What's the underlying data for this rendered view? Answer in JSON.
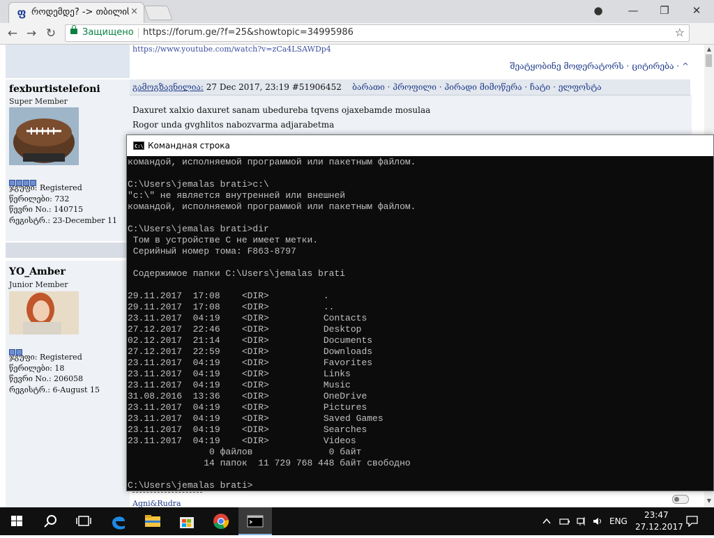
{
  "browser": {
    "tab_title": "როდემდე? -> თბილის",
    "tab_close": "×",
    "favicon": "ფ",
    "secure_label": "Защищено",
    "url": "https://forum.ge/?f=25&showtopic=34995986",
    "window_controls": {
      "profile_icon": "●",
      "minimize": "—",
      "restore": "❐",
      "close": "✕"
    },
    "nav": {
      "back": "←",
      "forward": "→",
      "reload": "↻",
      "bookmark": "☆"
    }
  },
  "forum": {
    "prev_post_link": "https://www.youtube.com/watch?v=zCa4LSAWDp4",
    "prev_post_actions": "შეატყობინე მოდერატორს · ციტირება · ^",
    "posts": [
      {
        "author": "fexburtistelefoni",
        "rank": "Super Member",
        "pips": 4,
        "meta": [
          "ჯგუფი: Registered",
          "წერილები: 732",
          "წევრი No.: 140715",
          "რეგისტრ.: 23-December 11"
        ],
        "header_label": "გამოგზავნილია:",
        "header_date": "27 Dec 2017, 23:19",
        "header_id": "#51906452",
        "header_links": "ბარათი · პროფილი · პირადი მიმოწერა · ჩატი · ელფოსტა",
        "lines": [
          "Daxuret xalxio daxuret sanam ubedureba tqvens ojaxebamde mosulaa",
          "Rogor unda gvghlitos nabozvarma adjarabetma"
        ]
      },
      {
        "author": "YO_Amber",
        "rank": "Junior Member",
        "pips": 2,
        "meta": [
          "ჯგუფი: Registered",
          "წერილები: 18",
          "წევრი No.: 206058",
          "რეგისტრ.: 6-August 15"
        ],
        "signature": "Agni&Rudra"
      }
    ]
  },
  "cmd": {
    "title": "Командная строка",
    "icon_text": "C:\\",
    "lines": [
      "командой, исполняемой программой или пакетным файлом.",
      "",
      "C:\\Users\\jemalas brati>c:\\",
      "\"c:\\\" не является внутренней или внешней",
      "командой, исполняемой программой или пакетным файлом.",
      "",
      "C:\\Users\\jemalas brati>dir",
      " Том в устройстве C не имеет метки.",
      " Серийный номер тома: F863-8797",
      "",
      " Содержимое папки C:\\Users\\jemalas brati",
      "",
      "29.11.2017  17:08    <DIR>          .",
      "29.11.2017  17:08    <DIR>          ..",
      "23.11.2017  04:19    <DIR>          Contacts",
      "27.12.2017  22:46    <DIR>          Desktop",
      "02.12.2017  21:14    <DIR>          Documents",
      "27.12.2017  22:59    <DIR>          Downloads",
      "23.11.2017  04:19    <DIR>          Favorites",
      "23.11.2017  04:19    <DIR>          Links",
      "23.11.2017  04:19    <DIR>          Music",
      "31.08.2016  13:36    <DIR>          OneDrive",
      "23.11.2017  04:19    <DIR>          Pictures",
      "23.11.2017  04:19    <DIR>          Saved Games",
      "23.11.2017  04:19    <DIR>          Searches",
      "23.11.2017  04:19    <DIR>          Videos",
      "               0 файлов              0 байт",
      "              14 папок  11 729 768 448 байт свободно",
      "",
      "C:\\Users\\jemalas brati>"
    ]
  },
  "taskbar": {
    "language": "ENG",
    "time": "23:47",
    "date": "27.12.2017",
    "apps": [
      "start-icon",
      "search-icon",
      "task-view-icon",
      "edge-icon",
      "file-explorer-icon",
      "store-icon",
      "chrome-icon",
      "cmd-icon"
    ]
  }
}
